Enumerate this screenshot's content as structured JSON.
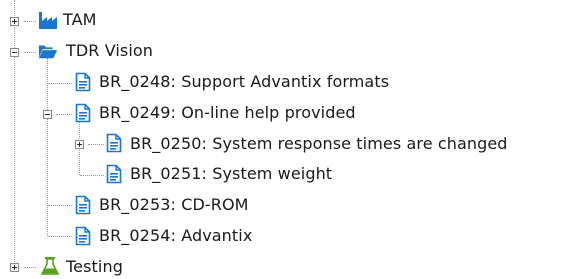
{
  "tree": {
    "nodes": [
      {
        "label": "TAM",
        "icon": "factory-icon"
      },
      {
        "label": "TDR Vision",
        "icon": "open-folder-icon"
      },
      {
        "label": "BR_0248: Support Advantix formats",
        "icon": "document-icon"
      },
      {
        "label": "BR_0249: On-line help provided",
        "icon": "document-icon"
      },
      {
        "label": "BR_0250: System response times are changed",
        "icon": "document-icon"
      },
      {
        "label": "BR_0251: System weight",
        "icon": "document-icon"
      },
      {
        "label": "BR_0253: CD-ROM",
        "icon": "document-icon"
      },
      {
        "label": "BR_0254: Advantix",
        "icon": "document-icon"
      },
      {
        "label": "Testing",
        "icon": "flask-icon"
      }
    ]
  },
  "colors": {
    "icon_blue": "#1976d2",
    "flask_green": "#5aa321",
    "connector_gray": "#9a9a9a"
  }
}
